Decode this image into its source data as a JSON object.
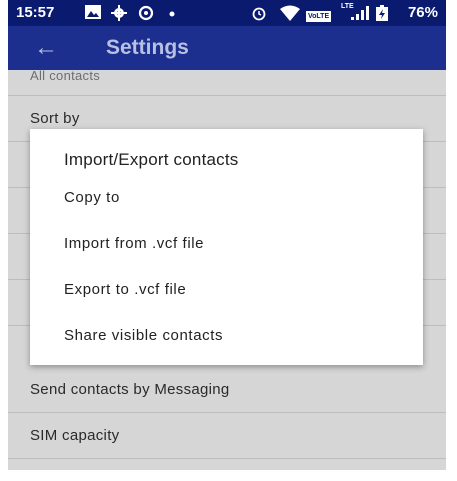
{
  "status_bar": {
    "time": "15:57",
    "icons": [
      "image-icon",
      "gear-icon",
      "sync-icon",
      "dot-icon",
      "alarm-icon",
      "wifi-icon",
      "volte-icon",
      "signal-icon",
      "battery-icon"
    ],
    "volte": "VoLTE",
    "lte": "LTE",
    "battery": "76%"
  },
  "app_bar": {
    "title": "Settings"
  },
  "settings_list": [
    {
      "label": "All contacts"
    },
    {
      "label": "Sort by"
    },
    {
      "label": ""
    },
    {
      "label": ""
    },
    {
      "label": ""
    },
    {
      "label": ""
    },
    {
      "label": "Send contacts by Messaging"
    },
    {
      "label": "SIM capacity"
    }
  ],
  "dialog": {
    "title": "Import/Export contacts",
    "items": [
      {
        "label": "Copy to"
      },
      {
        "label": "Import from .vcf file"
      },
      {
        "label": "Export to .vcf file"
      },
      {
        "label": "Share visible contacts"
      }
    ]
  },
  "colors": {
    "status_bar": "#0a1a6e",
    "app_bar": "#1c2f8f",
    "scrim_background": "#d6d6d6",
    "dialog": "#ffffff"
  }
}
